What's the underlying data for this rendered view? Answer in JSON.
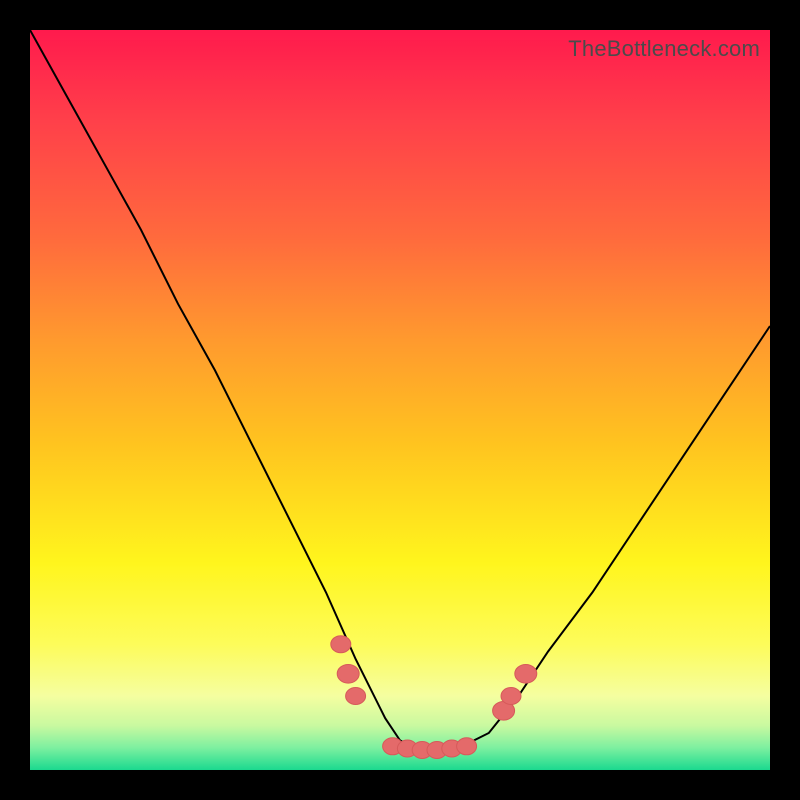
{
  "watermark": "TheBottleneck.com",
  "chart_data": {
    "type": "line",
    "title": "",
    "xlabel": "",
    "ylabel": "",
    "xlim": [
      0,
      100
    ],
    "ylim": [
      0,
      100
    ],
    "grid": false,
    "legend": false,
    "series": [
      {
        "name": "curve",
        "x": [
          0,
          5,
          10,
          15,
          20,
          25,
          30,
          36,
          40,
          44,
          48,
          50,
          52,
          55,
          58,
          62,
          66,
          70,
          76,
          82,
          88,
          94,
          100
        ],
        "y": [
          100,
          91,
          82,
          73,
          63,
          54,
          44,
          32,
          24,
          15,
          7,
          4,
          3,
          3,
          3,
          5,
          10,
          16,
          24,
          33,
          42,
          51,
          60
        ]
      }
    ],
    "markers": [
      {
        "x": 42,
        "y": 17,
        "size": 10
      },
      {
        "x": 43,
        "y": 13,
        "size": 11
      },
      {
        "x": 44,
        "y": 10,
        "size": 10
      },
      {
        "x": 49,
        "y": 3.2,
        "size": 10
      },
      {
        "x": 51,
        "y": 2.9,
        "size": 10
      },
      {
        "x": 53,
        "y": 2.7,
        "size": 10
      },
      {
        "x": 55,
        "y": 2.7,
        "size": 10
      },
      {
        "x": 57,
        "y": 2.9,
        "size": 10
      },
      {
        "x": 59,
        "y": 3.2,
        "size": 10
      },
      {
        "x": 64,
        "y": 8,
        "size": 11
      },
      {
        "x": 65,
        "y": 10,
        "size": 10
      },
      {
        "x": 67,
        "y": 13,
        "size": 11
      }
    ],
    "colors": {
      "gradient_top": "#ff1a4d",
      "gradient_mid1": "#ff9a2e",
      "gradient_mid2": "#fff51d",
      "gradient_bottom": "#1bd98f",
      "curve": "#000000",
      "marker_fill": "#e46a6a"
    }
  }
}
